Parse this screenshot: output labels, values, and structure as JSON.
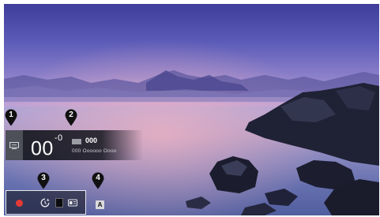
{
  "info_bar": {
    "time_main": "00",
    "time_sup": "-0",
    "program_title": "000",
    "program_sub": "000 Oooooo Oooo"
  },
  "icons": {
    "channel": "tv-icon",
    "record": "record-icon",
    "timeshift": "timeshift-icon",
    "channel_list": "channel-list-icon",
    "guide": "guide-icon",
    "accessibility": "a-icon"
  },
  "accessibility_label": "A",
  "callouts": [
    "1",
    "2",
    "3",
    "4"
  ],
  "colors": {
    "record": "#e53935",
    "callout": "#111111"
  }
}
